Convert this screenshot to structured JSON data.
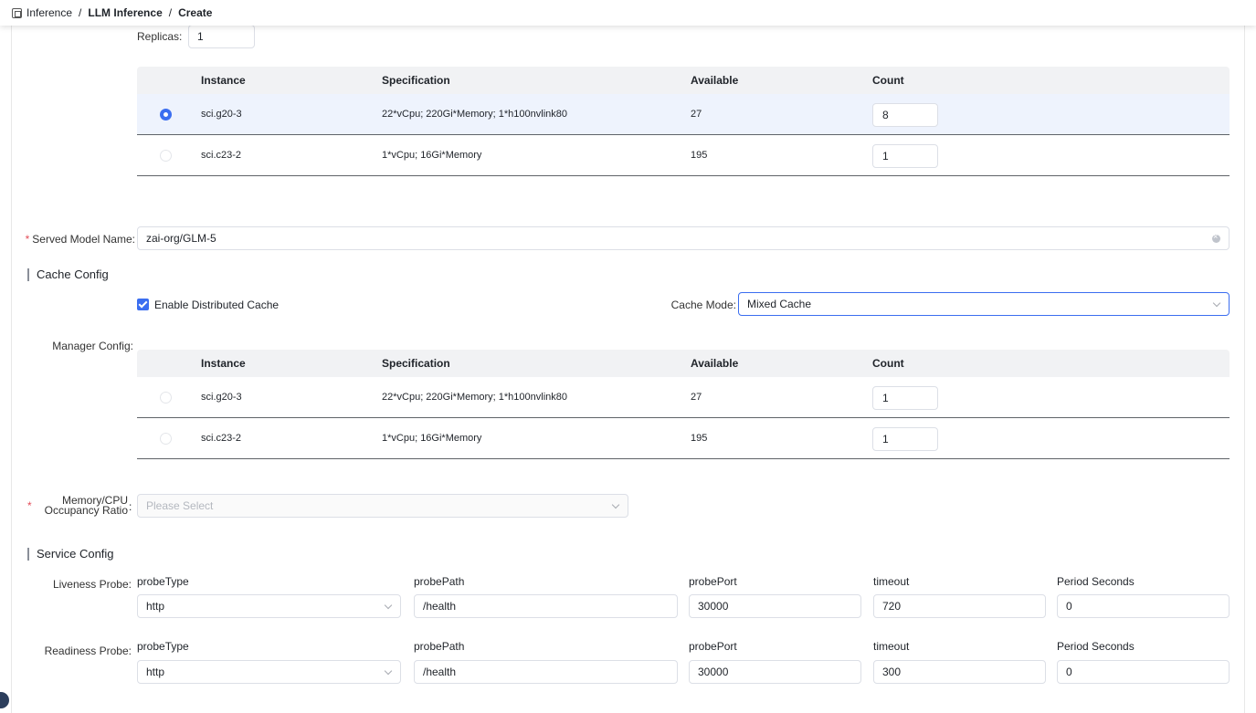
{
  "breadcrumb": {
    "root": "Inference",
    "section": "LLM Inference",
    "page": "Create"
  },
  "replicas": {
    "label": "Replicas",
    "value": "1"
  },
  "instance_table": {
    "headers": {
      "instance": "Instance",
      "specification": "Specification",
      "available": "Available",
      "count": "Count"
    },
    "rows": [
      {
        "instance": "sci.g20-3",
        "specification": "22*vCpu; 220Gi*Memory; 1*h100nvlink80",
        "available": "27",
        "count": "8",
        "selected": true
      },
      {
        "instance": "sci.c23-2",
        "specification": "1*vCpu; 16Gi*Memory",
        "available": "195",
        "count": "1",
        "selected": false
      }
    ]
  },
  "served_model": {
    "label": "Served Model Name",
    "value": "zai-org/GLM-5"
  },
  "cache_config": {
    "title": "Cache Config",
    "enable_label": "Enable Distributed Cache",
    "enabled": true,
    "mode_label": "Cache Mode",
    "mode_value": "Mixed Cache",
    "manager_label": "Manager Config"
  },
  "manager_table": {
    "headers": {
      "instance": "Instance",
      "specification": "Specification",
      "available": "Available",
      "count": "Count"
    },
    "rows": [
      {
        "instance": "sci.g20-3",
        "specification": "22*vCpu; 220Gi*Memory; 1*h100nvlink80",
        "available": "27",
        "count": "1",
        "selected": false
      },
      {
        "instance": "sci.c23-2",
        "specification": "1*vCpu; 16Gi*Memory",
        "available": "195",
        "count": "1",
        "selected": false
      }
    ]
  },
  "memory_ratio": {
    "label_line1": "Memory/CPU",
    "label_line2": "Occupancy Ratio",
    "placeholder": "Please Select"
  },
  "service_config": {
    "title": "Service Config",
    "field_labels": {
      "probe_type": "probeType",
      "probe_path": "probePath",
      "probe_port": "probePort",
      "timeout": "timeout",
      "period": "Period Seconds"
    },
    "liveness": {
      "label": "Liveness Probe",
      "probe_type": "http",
      "probe_path": "/health",
      "probe_port": "30000",
      "timeout": "720",
      "period": "0"
    },
    "readiness": {
      "label": "Readiness Probe",
      "probe_type": "http",
      "probe_path": "/health",
      "probe_port": "30000",
      "timeout": "300",
      "period": "0"
    }
  },
  "colors": {
    "accent": "#3b6ef0",
    "required": "#e34d59",
    "selected_row": "#eef3fd"
  }
}
